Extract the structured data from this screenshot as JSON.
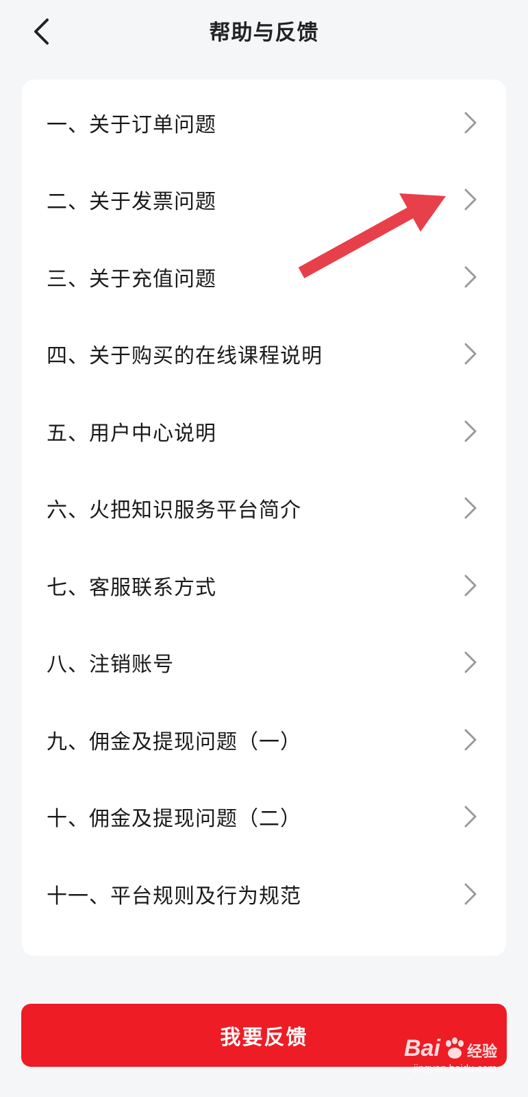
{
  "navbar": {
    "title": "帮助与反馈"
  },
  "help_items": [
    {
      "label": "一、关于订单问题"
    },
    {
      "label": "二、关于发票问题"
    },
    {
      "label": "三、关于充值问题"
    },
    {
      "label": "四、关于购买的在线课程说明"
    },
    {
      "label": "五、用户中心说明"
    },
    {
      "label": "六、火把知识服务平台简介"
    },
    {
      "label": "七、客服联系方式"
    },
    {
      "label": "八、注销账号"
    },
    {
      "label": "九、佣金及提现问题（一）"
    },
    {
      "label": "十、佣金及提现问题（二）"
    },
    {
      "label": "十一、平台规则及行为规范"
    }
  ],
  "feedback_button": {
    "label": "我要反馈"
  },
  "watermark": {
    "brand": "Bai",
    "cn": "经验",
    "sub": "jingyan.baidu.com"
  },
  "colors": {
    "accent": "#ee1c25",
    "annotation_arrow": "#e8404a",
    "background": "#f5f6f8",
    "chevron": "#9a9a9a"
  }
}
